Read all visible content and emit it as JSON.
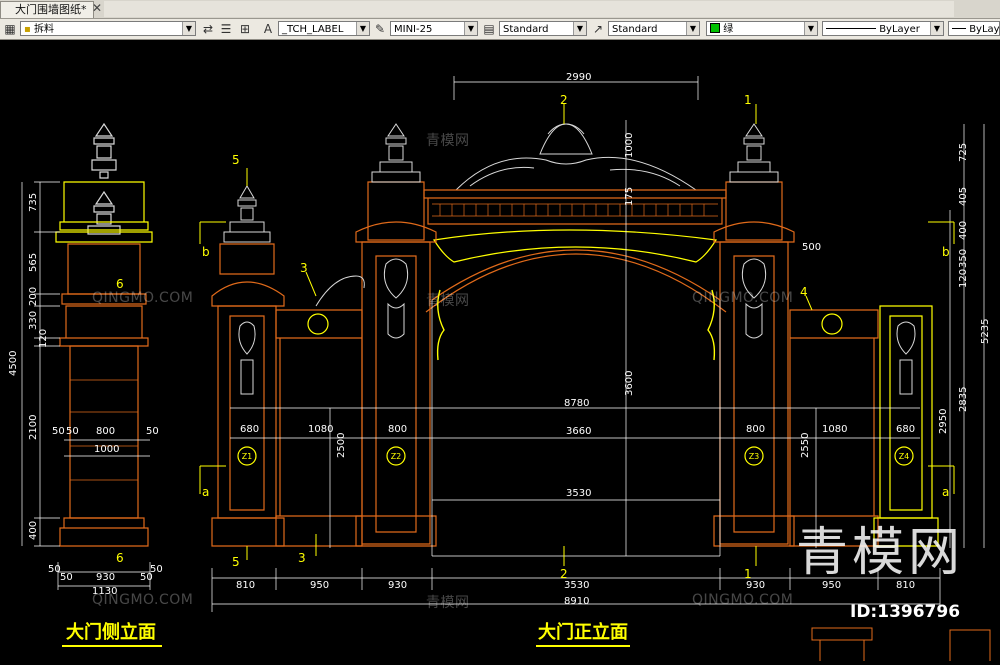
{
  "window": {
    "tab_title": "大门围墙图纸*",
    "tab_close": "✕"
  },
  "toolbar": {
    "layer_name": "拆料",
    "text_style": "_TCH_LABEL",
    "dim_style": "MINI-25",
    "table_style": "Standard",
    "multileader_style": "Standard",
    "color": "绿",
    "color_hex": "#00c000",
    "linetype": "ByLayer",
    "lineweight": "ByLayer"
  },
  "drawing": {
    "side_title": "大门侧立面",
    "front_title": "大门正立面",
    "markers": {
      "m1": "1",
      "m2": "2",
      "m3": "3",
      "m4": "4",
      "m5": "5",
      "m6": "6",
      "a": "a",
      "b": "b"
    },
    "columns": {
      "z1": "Z1",
      "z2": "Z2",
      "z3": "Z3",
      "z4": "Z4"
    },
    "dims": {
      "top_2990": "2990",
      "d_500": "500",
      "d_8780": "8780",
      "d_3660": "3660",
      "d_3530_inner": "3530",
      "d_3600": "3600",
      "d_1000": "1000",
      "d_175": "175",
      "d_680_l": "680",
      "d_1080_l": "1080",
      "d_800_l": "800",
      "d_800_r": "800",
      "d_1080_r": "1080",
      "d_680_r": "680",
      "d_2500": "2500",
      "d_2550": "2550",
      "d_2950": "2950",
      "d_725": "725",
      "d_405": "405",
      "d_400": "400",
      "d_350": "350",
      "d_120r": "120",
      "d_5235": "5235",
      "d_2835": "2835",
      "side_735": "735",
      "side_565": "565",
      "side_200": "200",
      "side_330": "330",
      "side_120": "120",
      "side_4500": "4500",
      "side_2100": "2100",
      "side_400": "400",
      "side_50a": "50",
      "side_50b": "50",
      "side_800": "800",
      "side_50c": "50",
      "side_1000": "1000",
      "side_50d": "50",
      "side_930": "930",
      "side_50e": "50",
      "side_50f": "50",
      "side_1130": "1130",
      "side_50g": "50",
      "bot_810_l": "810",
      "bot_950_l": "950",
      "bot_930_l": "930",
      "bot_3530": "3530",
      "bot_930_r": "930",
      "bot_950_r": "950",
      "bot_810_r": "810",
      "bot_8910": "8910"
    }
  },
  "watermark": {
    "brand": "QINGMO.COM",
    "brand_cn": "青模网",
    "big": "青模网",
    "id_label": "ID:1396796"
  }
}
